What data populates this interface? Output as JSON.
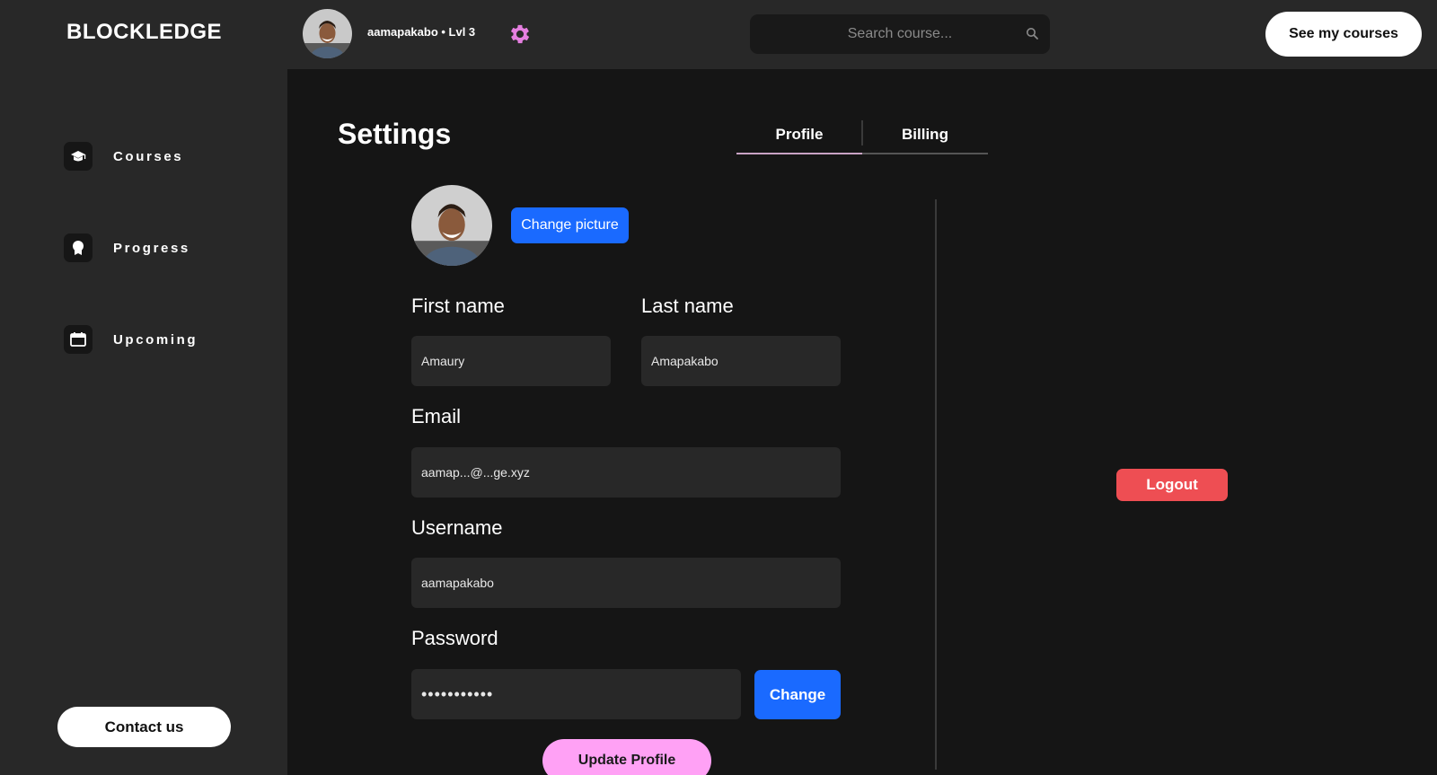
{
  "app": {
    "brand": "BLOCKLEDGE"
  },
  "sidebar": {
    "items": [
      {
        "label": "Courses",
        "icon": "graduation-cap-icon"
      },
      {
        "label": "Progress",
        "icon": "award-ribbon-icon"
      },
      {
        "label": "Upcoming",
        "icon": "calendar-icon"
      }
    ],
    "contact_label": "Contact us"
  },
  "topbar": {
    "user_label": "aamapakabo • Lvl 3",
    "search_placeholder": "Search course...",
    "see_courses_label": "See my courses"
  },
  "settings": {
    "title": "Settings",
    "tabs": [
      {
        "label": "Profile",
        "active": true
      },
      {
        "label": "Billing",
        "active": false
      }
    ],
    "change_picture_label": "Change picture",
    "fields": {
      "first_name": {
        "label": "First name",
        "value": "Amaury"
      },
      "last_name": {
        "label": "Last name",
        "value": "Amapakabo"
      },
      "email": {
        "label": "Email",
        "value": "aamap...@...ge.xyz"
      },
      "username": {
        "label": "Username",
        "value": "aamapakabo"
      },
      "password": {
        "label": "Password",
        "value": "•••••••••••"
      }
    },
    "change_password_label": "Change",
    "update_profile_label": "Update Profile",
    "logout_label": "Logout"
  },
  "colors": {
    "accent_pink": "#ffa1f5",
    "gear_pink": "#e57fe0",
    "primary_blue": "#1a6aff",
    "danger_red": "#ee4e53",
    "sidebar_bg": "#282828",
    "main_bg": "#151515"
  }
}
